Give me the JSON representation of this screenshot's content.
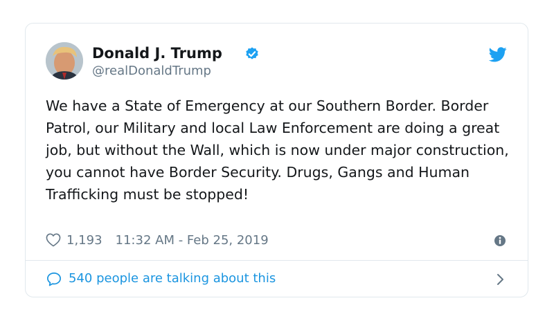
{
  "tweet": {
    "author": {
      "display_name": "Donald J. Trump",
      "handle": "@realDonaldTrump",
      "verified": true
    },
    "text": "We have a State of Emergency at our Southern Border. Border Patrol, our Military and local Law Enforcement are doing a great job, but without the Wall, which is now under major construction, you cannot have Border Security. Drugs, Gangs and Human Trafficking must be stopped!",
    "likes": "1,193",
    "timestamp": "11:32 AM - Feb 25, 2019",
    "talking_about": "540 people are talking about this"
  },
  "icons": {
    "verified": "verified-badge-icon",
    "brand": "twitter-bird-icon",
    "like": "heart-icon",
    "info": "info-icon",
    "reply": "speech-bubble-icon",
    "more": "chevron-right-icon"
  },
  "colors": {
    "accent": "#1da1f2",
    "link": "#1b95e0",
    "text": "#14171a",
    "secondary": "#657786",
    "border": "#e1e8ed"
  }
}
